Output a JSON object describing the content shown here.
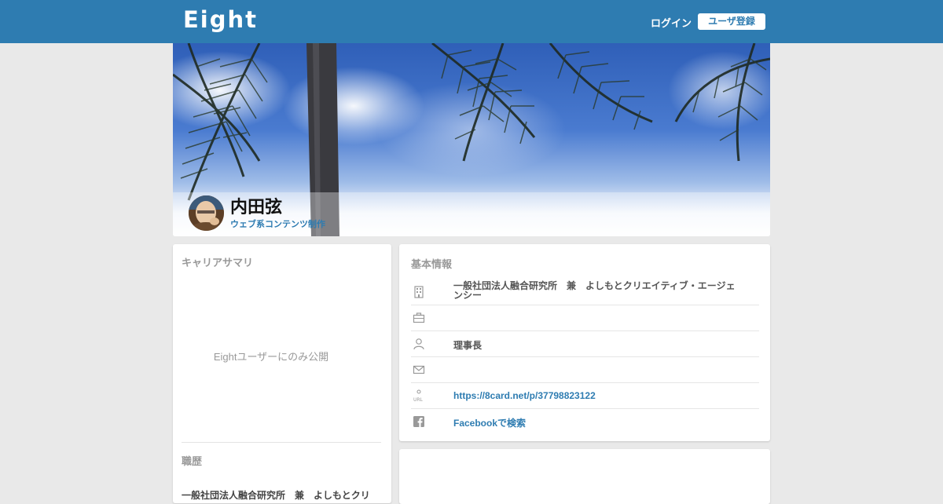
{
  "header": {
    "logo": "Eight",
    "login_label": "ログイン",
    "signup_label": "ユーザ登録",
    "bg_color": "#2e7cb1"
  },
  "profile": {
    "name": "内田弦",
    "title": "ウェブ系コンテンツ制作"
  },
  "career": {
    "summary_heading": "キャリアサマリ",
    "private_note": "Eightユーザーにのみ公開",
    "history_heading": "職歴",
    "history_first": "一般社団法人融合研究所　兼　よしもとクリ"
  },
  "info": {
    "heading": "基本情報",
    "rows": [
      {
        "icon": "building-icon",
        "value": "一般社団法人融合研究所　兼　よしもとクリエイティブ・エージェンシー"
      },
      {
        "icon": "briefcase-icon",
        "value": ""
      },
      {
        "icon": "person-icon",
        "value": "理事長"
      },
      {
        "icon": "mail-icon",
        "value": ""
      },
      {
        "icon": "url-icon",
        "value": "https://8card.net/p/37798823122"
      },
      {
        "icon": "facebook-icon",
        "value": "Facebookで検索"
      }
    ]
  }
}
